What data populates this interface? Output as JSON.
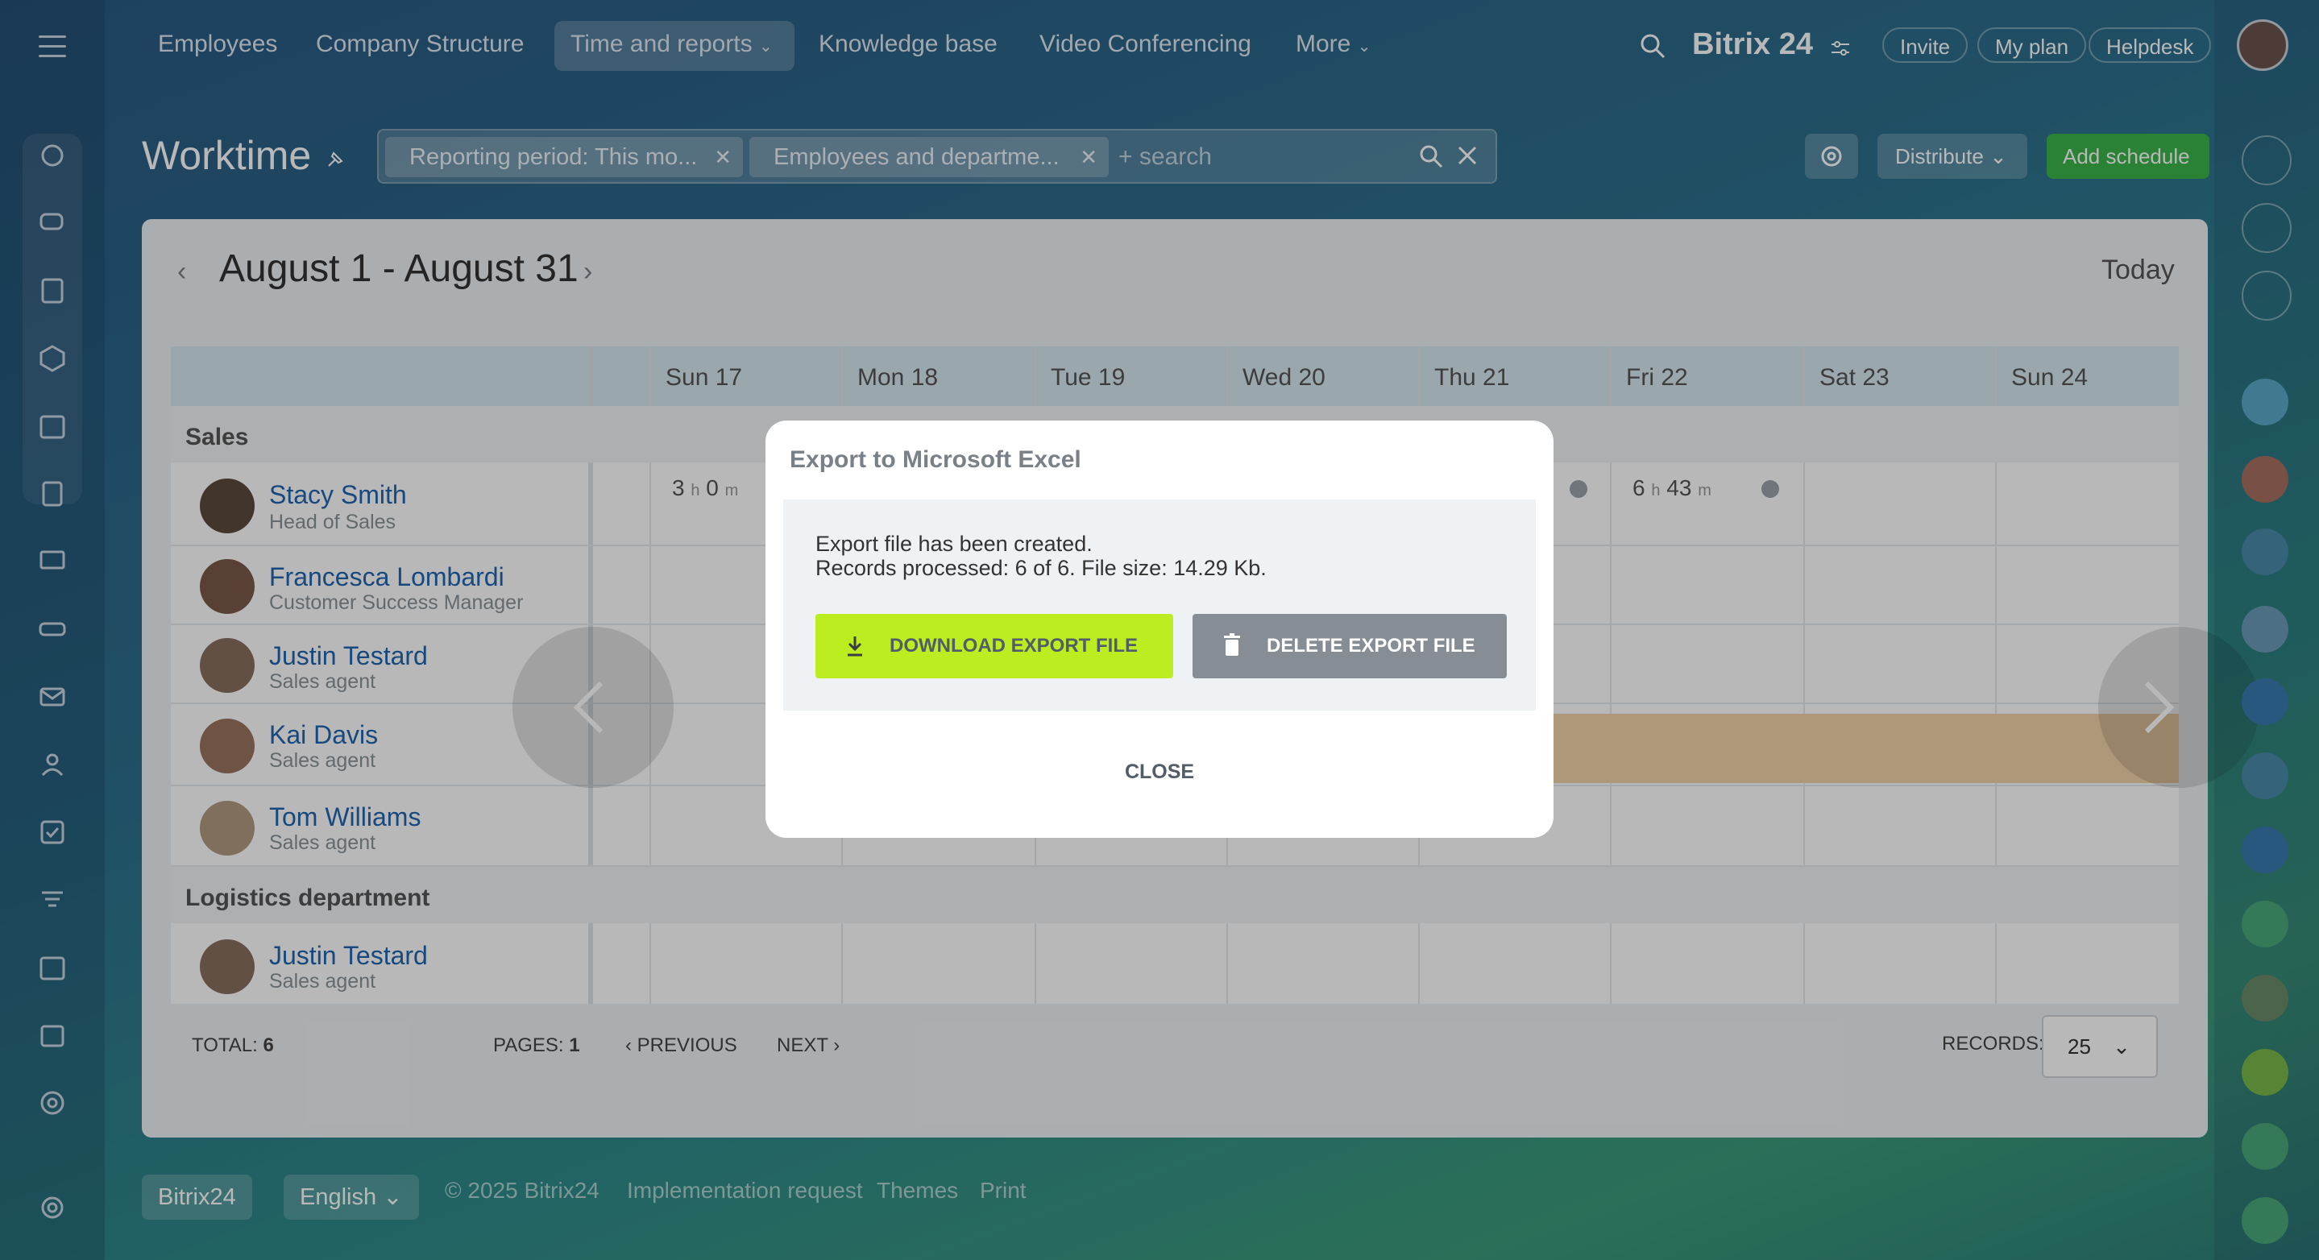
{
  "nav": {
    "items": [
      "Employees",
      "Company Structure",
      "Time and reports",
      "Knowledge base",
      "Video Conferencing",
      "More"
    ],
    "brand": "Bitrix 24",
    "invite": "Invite",
    "my_plan": "My plan",
    "helpdesk": "Helpdesk"
  },
  "page": {
    "title": "Worktime",
    "filters": [
      "Reporting period: This mo...",
      "Employees and departme..."
    ],
    "search_placeholder": "+ search",
    "distribute": "Distribute",
    "add_schedule": "Add schedule"
  },
  "calendar": {
    "period": "August 1 - August 31",
    "today": "Today",
    "columns": [
      "Sun 17",
      "Mon 18",
      "Tue 19",
      "Wed 20",
      "Thu 21",
      "Fri 22",
      "Sat 23",
      "Sun 24"
    ],
    "departments": [
      {
        "name": "Sales",
        "employees": [
          {
            "name": "Stacy Smith",
            "role": "Head of Sales"
          },
          {
            "name": "Francesca Lombardi",
            "role": "Customer Success Manager"
          },
          {
            "name": "Justin Testard",
            "role": "Sales agent"
          },
          {
            "name": "Kai Davis",
            "role": "Sales agent"
          },
          {
            "name": "Tom Williams",
            "role": "Sales agent"
          }
        ]
      },
      {
        "name": "Logistics department",
        "employees": [
          {
            "name": "Justin Testard",
            "role": "Sales agent"
          }
        ]
      }
    ],
    "times": {
      "sun17_h": "3",
      "sun17_m": "0",
      "fri22_h": "6",
      "fri22_m": "43",
      "h_unit": "h",
      "m_unit": "m"
    }
  },
  "pager": {
    "total_label": "TOTAL:",
    "total": "6",
    "pages_label": "PAGES:",
    "pages": "1",
    "previous": "PREVIOUS",
    "next": "NEXT",
    "records_label": "RECORDS:",
    "records": "25"
  },
  "modal": {
    "title": "Export to Microsoft Excel",
    "line1": "Export file has been created.",
    "line2": "Records processed: 6 of 6. File size: 14.29 Kb.",
    "download": "DOWNLOAD EXPORT FILE",
    "delete": "DELETE EXPORT FILE",
    "close": "CLOSE"
  },
  "footer": {
    "brand": "Bitrix24",
    "language": "English",
    "copyright": "© 2025 Bitrix24",
    "implementation": "Implementation request",
    "themes": "Themes",
    "print": "Print"
  },
  "colors": {
    "download_btn": "#bbed21",
    "delete_btn": "#868d95",
    "add_schedule": "#3bb54a",
    "link": "#2066b0"
  }
}
